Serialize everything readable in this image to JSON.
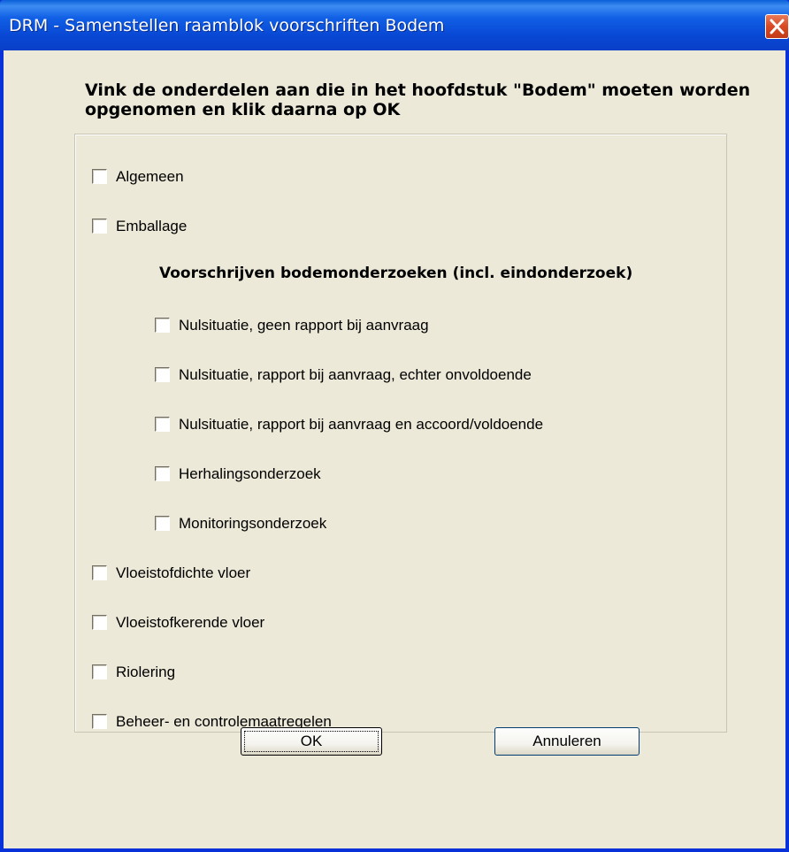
{
  "window": {
    "title": "DRM -  Samenstellen raamblok voorschriften Bodem"
  },
  "instruction": "Vink de onderdelen aan die in het hoofdstuk \"Bodem\" moeten worden opgenomen en klik daarna op OK",
  "options": {
    "algemeen": {
      "label": "Algemeen",
      "checked": false
    },
    "emballage": {
      "label": "Emballage",
      "checked": false
    },
    "section_heading": "Voorschrijven bodemonderzoeken (incl. eindonderzoek)",
    "nul_geen_rapport": {
      "label": "Nulsituatie, geen rapport bij aanvraag",
      "checked": false
    },
    "nul_onvoldoende": {
      "label": "Nulsituatie, rapport bij aanvraag, echter onvoldoende",
      "checked": false
    },
    "nul_voldoende": {
      "label": "Nulsituatie, rapport bij aanvraag en accoord/voldoende",
      "checked": false
    },
    "herhaling": {
      "label": "Herhalingsonderzoek",
      "checked": false
    },
    "monitoring": {
      "label": "Monitoringsonderzoek",
      "checked": false
    },
    "vloeistofdicht": {
      "label": "Vloeistofdichte vloer",
      "checked": false
    },
    "vloeistofkerend": {
      "label": "Vloeistofkerende vloer",
      "checked": false
    },
    "riolering": {
      "label": "Riolering",
      "checked": false
    },
    "beheer": {
      "label": "Beheer- en controlemaatregelen",
      "checked": false
    }
  },
  "buttons": {
    "ok": "OK",
    "cancel": "Annuleren"
  },
  "colors": {
    "titlebar": "#0a4fd6",
    "dialog_background": "#ece9d8",
    "close_button": "#d84a22"
  }
}
